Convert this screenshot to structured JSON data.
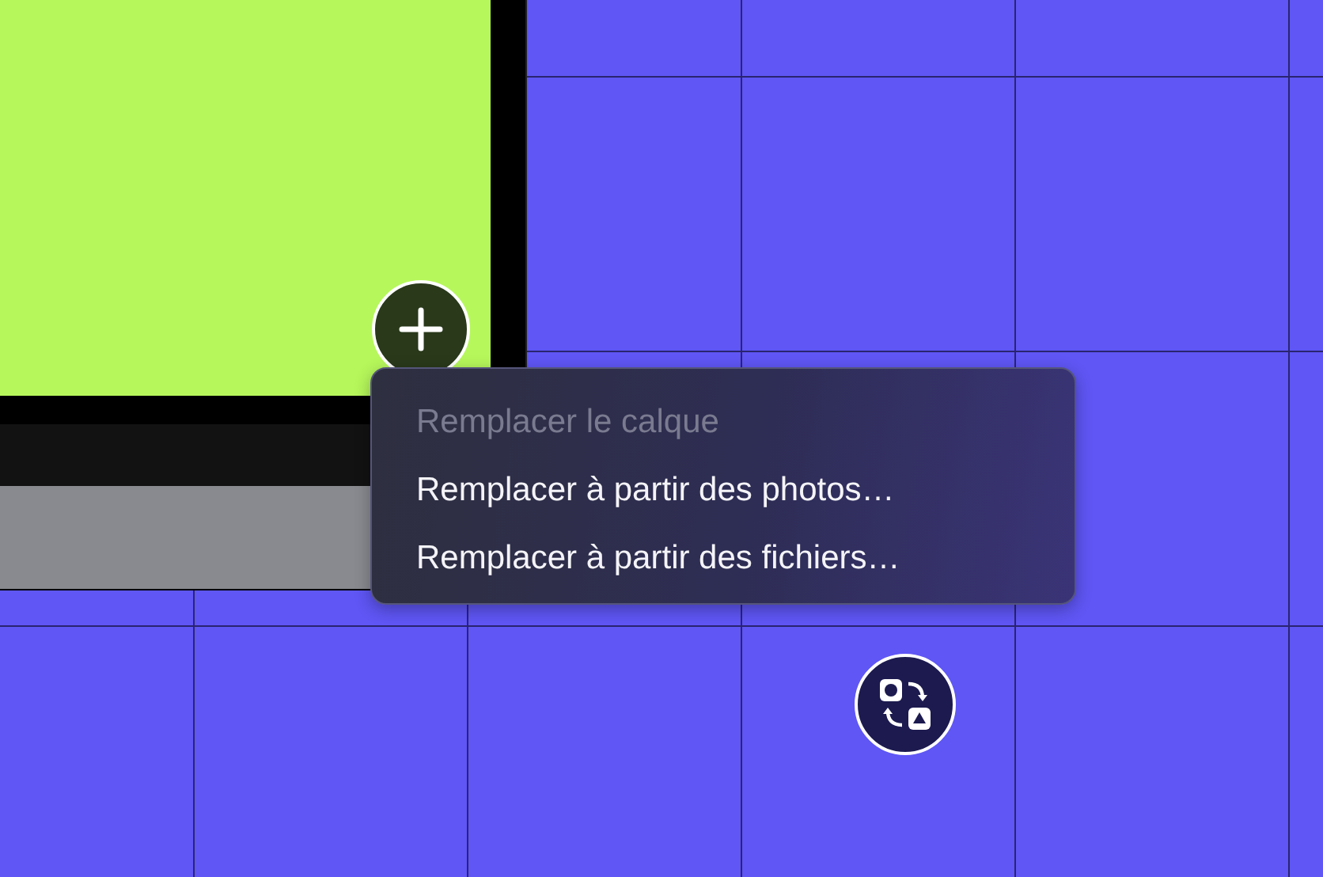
{
  "menu": {
    "items": [
      {
        "label": "Remplacer le calque",
        "disabled": true
      },
      {
        "label": "Remplacer à partir des photos…",
        "disabled": false
      },
      {
        "label": "Remplacer à partir des fichiers…",
        "disabled": false
      }
    ]
  }
}
